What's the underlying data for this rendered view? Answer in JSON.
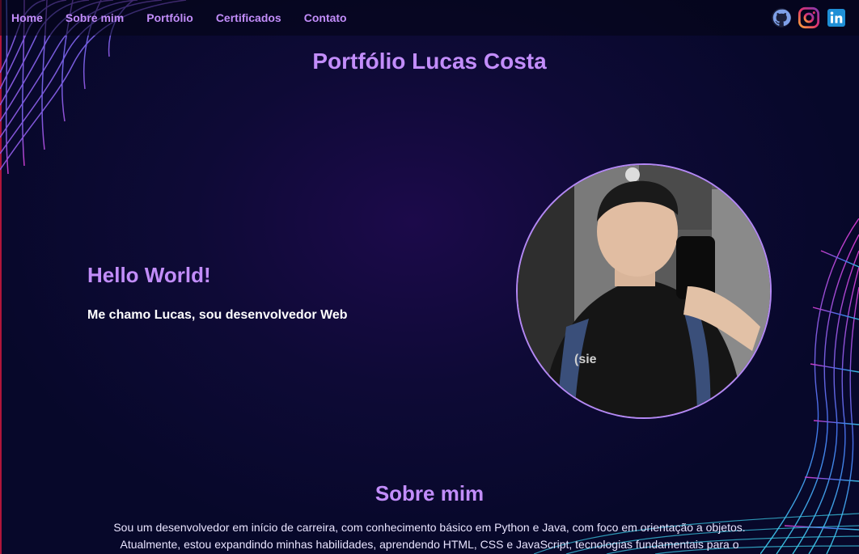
{
  "nav": {
    "links": [
      "Home",
      "Sobre mim",
      "Portfólio",
      "Certificados",
      "Contato"
    ],
    "socials": [
      "github-icon",
      "instagram-icon",
      "linkedin-icon"
    ]
  },
  "header": {
    "title": "Portfólio Lucas Costa"
  },
  "hero": {
    "greeting": "Hello World!",
    "intro": "Me chamo Lucas, sou desenvolvedor Web"
  },
  "about": {
    "title": "Sobre mim",
    "text": "Sou um desenvolvedor em início de carreira, com conhecimento básico em Python e Java, com foco em orientação a objetos. Atualmente, estou expandindo minhas habilidades, aprendendo HTML, CSS e JavaScript, tecnologias fundamentais para o"
  },
  "colors": {
    "accent": "#c28dfa",
    "background": "#07082a",
    "wave_pink": "#e23dd8",
    "wave_blue": "#4a7dff",
    "wave_cyan": "#3fd4f0"
  }
}
